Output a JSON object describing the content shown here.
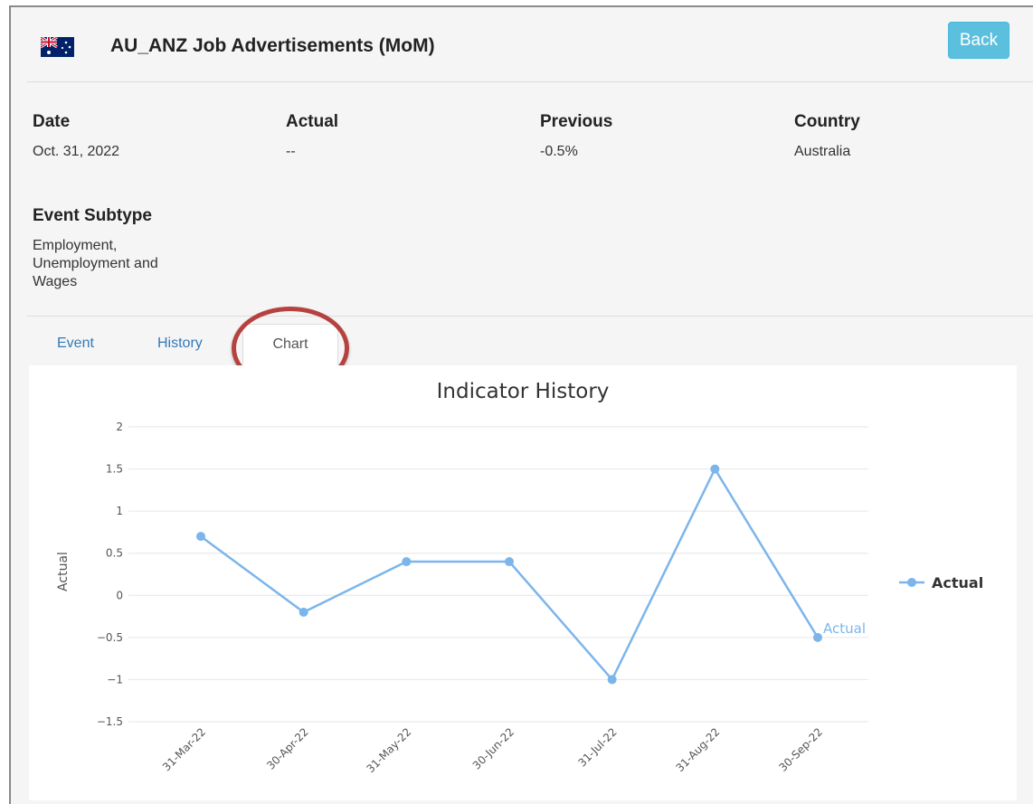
{
  "header": {
    "title": "AU_ANZ Job Advertisements (MoM)",
    "back_label": "Back",
    "flag_icon": "australia-flag-icon"
  },
  "details": {
    "date": {
      "label": "Date",
      "value": "Oct. 31, 2022"
    },
    "actual": {
      "label": "Actual",
      "value": "--"
    },
    "previous": {
      "label": "Previous",
      "value": "-0.5%"
    },
    "country": {
      "label": "Country",
      "value": "Australia"
    },
    "subtype": {
      "label": "Event Subtype",
      "value": "Employment, Unemployment and Wages"
    }
  },
  "tabs": [
    {
      "label": "Event"
    },
    {
      "label": "History"
    },
    {
      "label": "Chart",
      "active": true
    }
  ],
  "colors": {
    "accent": "#5bc0de",
    "link": "#337ab7",
    "series": "#7cb5ec",
    "highlight": "#b5423f"
  },
  "chart_data": {
    "type": "line",
    "title": "Indicator History",
    "ylabel": "Actual",
    "xlabel": "",
    "categories": [
      "31-Mar-22",
      "30-Apr-22",
      "31-May-22",
      "30-Jun-22",
      "31-Jul-22",
      "31-Aug-22",
      "30-Sep-22"
    ],
    "yticks": [
      "2",
      "1.5",
      "1",
      "0.5",
      "0",
      "−0.5",
      "−1",
      "−1.5"
    ],
    "ylim": [
      -1.5,
      2
    ],
    "grid": true,
    "legend": "right",
    "series": [
      {
        "name": "Actual",
        "values": [
          0.7,
          -0.2,
          0.4,
          0.4,
          -1.0,
          1.5,
          -0.5
        ],
        "end_label": "Actual"
      }
    ]
  }
}
